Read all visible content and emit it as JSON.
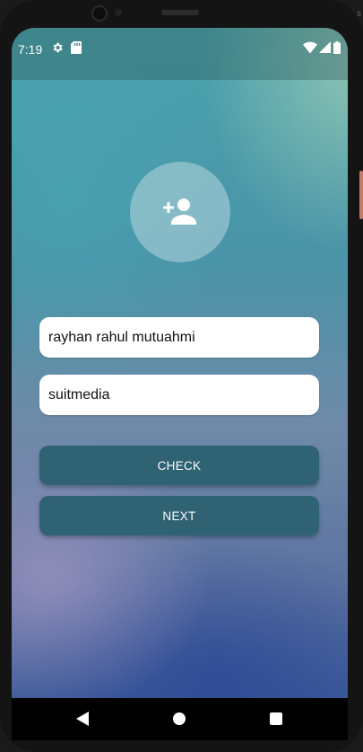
{
  "status_bar": {
    "time": "7:19",
    "icons": [
      "gear-icon",
      "sd-card-icon",
      "wifi-icon",
      "signal-icon",
      "battery-icon"
    ]
  },
  "device_edge_text": "s",
  "profile": {
    "avatar_icon": "add-person-icon"
  },
  "form": {
    "name_value": "rayhan rahul mutuahmi",
    "palindrome_value": "suitmedia"
  },
  "buttons": {
    "check_label": "CHECK",
    "next_label": "NEXT"
  },
  "navigation": {
    "icons": [
      "back-icon",
      "home-icon",
      "recents-icon"
    ]
  },
  "colors": {
    "button": "#2f6273",
    "input_background": "#ffffff",
    "text_light": "#ffffff"
  }
}
